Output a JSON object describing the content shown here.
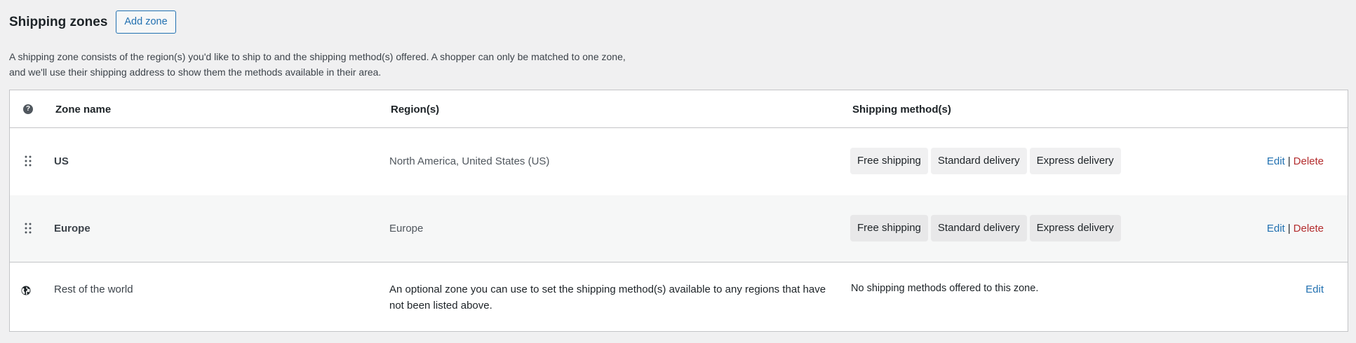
{
  "header": {
    "title": "Shipping zones",
    "add_zone_label": "Add zone"
  },
  "description": "A shipping zone consists of the region(s) you'd like to ship to and the shipping method(s) offered. A shopper can only be matched to one zone, and we'll use their shipping address to show them the methods available in their area.",
  "table": {
    "columns": {
      "zone_name": "Zone name",
      "regions": "Region(s)",
      "shipping_methods": "Shipping method(s)"
    },
    "zones": [
      {
        "name": "US",
        "regions": "North America, United States (US)",
        "methods": [
          "Free shipping",
          "Standard delivery",
          "Express delivery"
        ],
        "edit_label": "Edit",
        "separator": "|",
        "delete_label": "Delete"
      },
      {
        "name": "Europe",
        "regions": "Europe",
        "methods": [
          "Free shipping",
          "Standard delivery",
          "Express delivery"
        ],
        "edit_label": "Edit",
        "separator": "|",
        "delete_label": "Delete"
      }
    ],
    "rest_of_world": {
      "name": "Rest of the world",
      "description": "An optional zone you can use to set the shipping method(s) available to any regions that have not been listed above.",
      "no_methods": "No shipping methods offered to this zone.",
      "edit_label": "Edit"
    }
  },
  "icons": {
    "help": "help-icon",
    "drag": "drag-handle-icon",
    "globe": "globe-icon"
  },
  "colors": {
    "link": "#2271b1",
    "delete": "#b32d2e",
    "background": "#f0f0f1"
  }
}
